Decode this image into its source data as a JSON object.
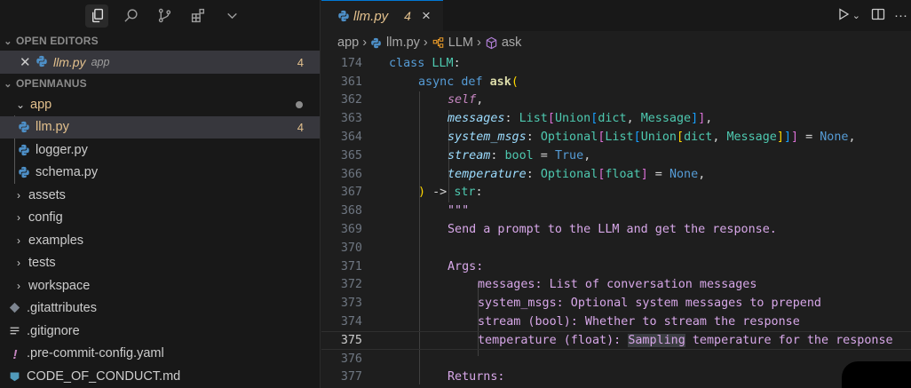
{
  "activity_bar": {
    "icons": [
      "explorer-icon",
      "search-icon",
      "source-control-icon",
      "extensions-icon",
      "chevron-down-icon"
    ]
  },
  "open_editors": {
    "title": "OPEN EDITORS",
    "items": [
      {
        "name": "llm.py",
        "dir": "app",
        "problems": "4"
      }
    ]
  },
  "workspace": {
    "title": "OPENMANUS",
    "tree": [
      {
        "label": "app",
        "type": "folder-open",
        "modified": true
      },
      {
        "label": "llm.py",
        "type": "py",
        "problems": "4",
        "selected": true
      },
      {
        "label": "logger.py",
        "type": "py"
      },
      {
        "label": "schema.py",
        "type": "py"
      },
      {
        "label": "assets",
        "type": "folder"
      },
      {
        "label": "config",
        "type": "folder"
      },
      {
        "label": "examples",
        "type": "folder"
      },
      {
        "label": "tests",
        "type": "folder"
      },
      {
        "label": "workspace",
        "type": "folder"
      },
      {
        "label": ".gitattributes",
        "type": "git"
      },
      {
        "label": ".gitignore",
        "type": "list"
      },
      {
        "label": ".pre-commit-config.yaml",
        "type": "yaml"
      },
      {
        "label": "CODE_OF_CONDUCT.md",
        "type": "md"
      }
    ]
  },
  "tab": {
    "name": "llm.py",
    "count": "4",
    "close": "×"
  },
  "tab_actions": [
    "run-icon",
    "chevron-down-icon",
    "split-editor-icon",
    "more-icon"
  ],
  "breadcrumb": [
    "app",
    "llm.py",
    "LLM",
    "ask"
  ],
  "code": {
    "current_line": "375",
    "lines": [
      {
        "n": "174",
        "sticky": true
      },
      {
        "n": "361"
      },
      {
        "n": "362"
      },
      {
        "n": "363"
      },
      {
        "n": "364"
      },
      {
        "n": "365"
      },
      {
        "n": "366"
      },
      {
        "n": "367"
      },
      {
        "n": "368"
      },
      {
        "n": "369"
      },
      {
        "n": "370"
      },
      {
        "n": "371"
      },
      {
        "n": "372"
      },
      {
        "n": "373"
      },
      {
        "n": "374"
      },
      {
        "n": "375"
      },
      {
        "n": "376"
      },
      {
        "n": "377"
      }
    ],
    "text": {
      "l174_kw": "class",
      "l174_name": "LLM",
      "l174_colon": ":",
      "l361_kw": "async def",
      "l361_fn": "ask",
      "l361_paren": "(",
      "l362_self": "self",
      "l362_comma": ",",
      "l363_p": "messages",
      "l363_rest_a": ": ",
      "l363_t1": "List",
      "l363_b1": "[",
      "l363_t2": "Union",
      "l363_b2": "[",
      "l363_t3": "dict",
      "l363_c": ", ",
      "l363_t4": "Message",
      "l363_b2c": "]",
      "l363_b1c": "]",
      "l363_end": ",",
      "l364_p": "system_msgs",
      "l364_rest_a": ": ",
      "l364_t0": "Optional",
      "l364_b0": "[",
      "l364_t1": "List",
      "l364_b1": "[",
      "l364_t2": "Union",
      "l364_b2": "[",
      "l364_t3": "dict",
      "l364_c": ", ",
      "l364_t4": "Message",
      "l364_b2c": "]",
      "l364_b1c": "]",
      "l364_b0c": "]",
      "l364_eq": " = ",
      "l364_none": "None",
      "l364_end": ",",
      "l365_p": "stream",
      "l365_a": ": ",
      "l365_t": "bool",
      "l365_eq": " = ",
      "l365_v": "True",
      "l365_end": ",",
      "l366_p": "temperature",
      "l366_a": ": ",
      "l366_t0": "Optional",
      "l366_b": "[",
      "l366_t1": "float",
      "l366_bc": "]",
      "l366_eq": " = ",
      "l366_v": "None",
      "l366_end": ",",
      "l367_paren": ")",
      "l367_arrow": " -> ",
      "l367_t": "str",
      "l367_colon": ":",
      "l368": "\"\"\"",
      "l369": "Send a prompt to the LLM and get the response.",
      "l371": "Args:",
      "l372": "messages: List of conversation messages",
      "l373": "system_msgs: Optional system messages to prepend",
      "l374": "stream (bool): Whether to stream the response",
      "l375_a": "temperature (float): ",
      "l375_hl": "Sampling",
      "l375_b": " temperature for the response",
      "l377": "Returns:"
    }
  },
  "colors": {
    "accent": "#0078d4",
    "modified": "#e2c08d",
    "sidebar_bg": "#181818",
    "editor_bg": "#1e1e1e"
  }
}
